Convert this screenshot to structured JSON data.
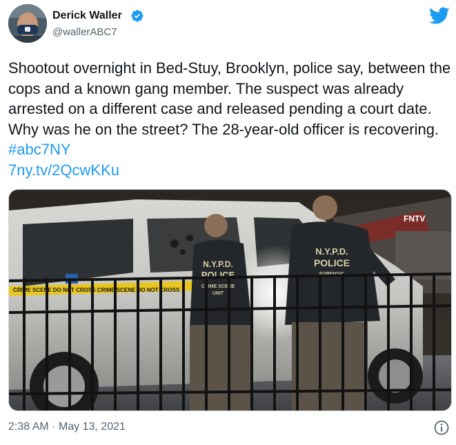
{
  "author": {
    "display_name": "Derick Waller",
    "handle": "@wallerABC7",
    "verified": true
  },
  "tweet": {
    "text_parts": [
      "Shootout overnight in Bed-Stuy, Brooklyn, police say, between the cops and a known gang member. The suspect was already arrested on a different case and released pending a court date. Why was he on the street? The 28-year-old officer is recovering. "
    ],
    "hashtag": "#abc7NY",
    "link": "7ny.tv/2QcwKKu"
  },
  "media": {
    "watermark": "FNTV",
    "vest_left": [
      "N.Y.P.D.",
      "POLICE",
      "CRIME SCENE",
      "UNIT"
    ],
    "vest_right": [
      "N.Y.P.D.",
      "POLICE",
      "FORENSIC"
    ],
    "tape_text": "CRIME SCENE  DO NOT CROSS  CRIME SCENE  DO NOT CROSS"
  },
  "meta": {
    "time": "2:38 AM",
    "separator": "·",
    "date": "May 13, 2021"
  },
  "colors": {
    "link": "#1d9bf0",
    "verified": "#1d9bf0",
    "logo": "#1d9bf0",
    "secondary_text": "#536471"
  },
  "icons": {
    "verified": "verified-badge-icon",
    "logo": "twitter-bird-icon",
    "info": "info-icon"
  }
}
